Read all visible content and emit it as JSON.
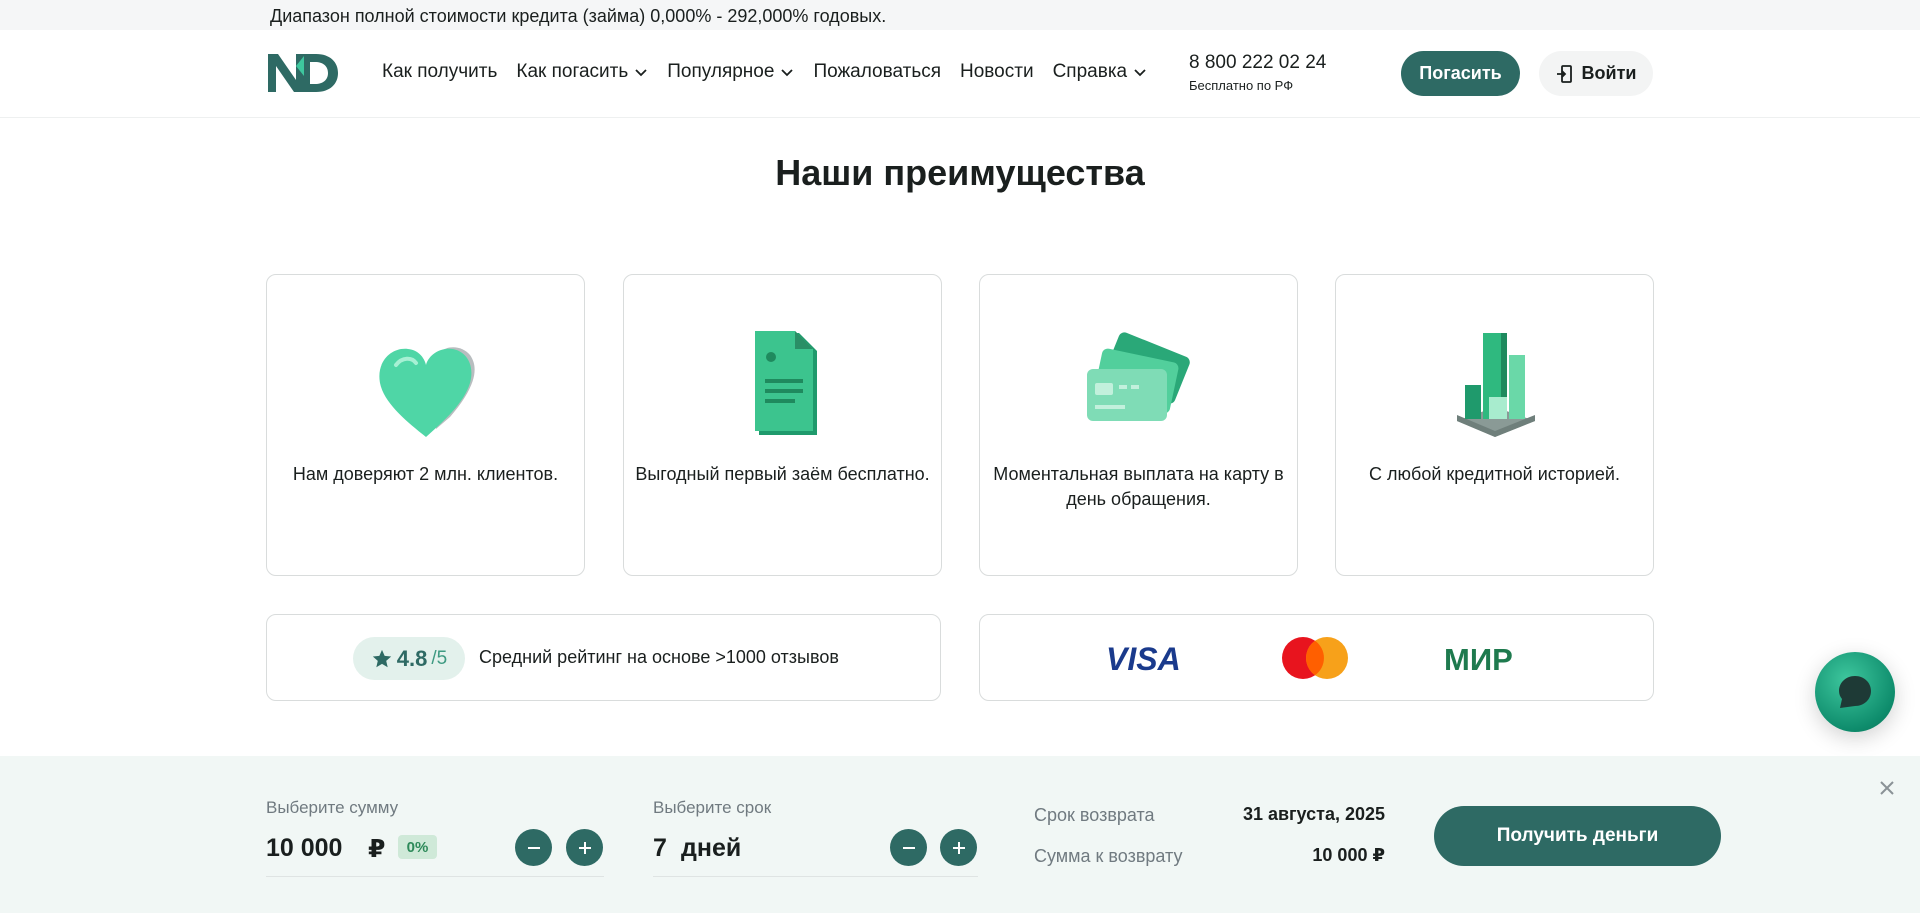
{
  "topbar": {
    "text": "Диапазон полной стоимости кредита (займа) 0,000% - 292,000% годовых."
  },
  "header": {
    "logo_text": "ND",
    "nav": [
      {
        "label": "Как получить",
        "has_dropdown": false
      },
      {
        "label": "Как погасить",
        "has_dropdown": true
      },
      {
        "label": "Популярное",
        "has_dropdown": true
      },
      {
        "label": "Пожаловаться",
        "has_dropdown": false
      },
      {
        "label": "Новости",
        "has_dropdown": false
      },
      {
        "label": "Справка",
        "has_dropdown": true
      }
    ],
    "phone": {
      "number": "8 800 222 02 24",
      "note": "Бесплатно по РФ"
    },
    "repay_label": "Погасить",
    "login_label": "Войти"
  },
  "advantages": {
    "title": "Наши преимущества",
    "cards": [
      {
        "icon": "heart-icon",
        "text": "Нам доверяют 2 млн. клиентов."
      },
      {
        "icon": "document-icon",
        "text": "Выгодный первый заём бесплатно."
      },
      {
        "icon": "cards-icon",
        "text": "Моментальная выплата на карту в день обращения."
      },
      {
        "icon": "growth-chart-icon",
        "text": "С любой кредитной историей."
      }
    ]
  },
  "rating": {
    "value": "4.8",
    "max": "/5",
    "text": "Средний рейтинг на основе >1000 отзывов"
  },
  "payments": {
    "visa": "VISA",
    "mir": "МИР"
  },
  "calculator": {
    "amount_label": "Выберите сумму",
    "amount_value": "10 000",
    "currency": "₽",
    "percent": "0%",
    "term_label": "Выберите срок",
    "term_value": "7",
    "term_unit": "дней",
    "return_date_label": "Срок возврата",
    "return_date_value": "31 августа, 2025",
    "return_sum_label": "Сумма к возврату",
    "return_sum_value": "10 000 ₽",
    "submit_label": "Получить деньги"
  },
  "colors": {
    "primary": "#2e6a64",
    "accent_green": "#3ec79e",
    "calc_bg": "#f1f7f5"
  }
}
